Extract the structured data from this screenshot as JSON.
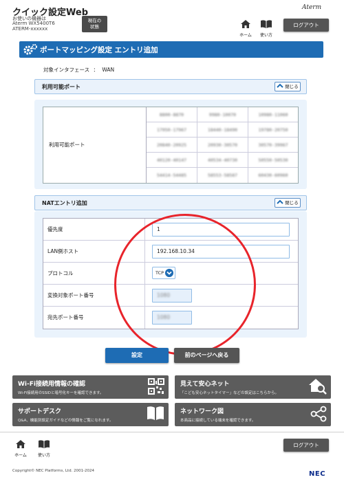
{
  "header": {
    "app_title": "クイック設定Web",
    "device_label": "お使いの機器は",
    "device_model": "Aterm WX5400T6",
    "device_id": "ATERM-xxxxxx",
    "status_button": "現在の\n状態",
    "brand": "Aterm",
    "nav_home": "ホーム",
    "nav_usage": "使い方",
    "logout": "ログアウト"
  },
  "page": {
    "title": "ポートマッピング設定 エントリ追加",
    "interface_label": "対象インタフェース",
    "interface_separator": "：",
    "interface_value": "WAN"
  },
  "available_ports": {
    "section_title": "利用可能ポート",
    "close_label": "閉じる",
    "row_label": "利用可能ポート",
    "cells": [
      [
        "8800-8870",
        "9980-10070",
        "10980-11060"
      ],
      [
        "17950-17967",
        "18440-18490",
        "19780-20750"
      ],
      [
        "20840-20925",
        "20930-30570",
        "30570-39967"
      ],
      [
        "40120-40147",
        "40534-40730",
        "50550-50530"
      ],
      [
        "54414-54485",
        "58553-58587",
        "60430-60960"
      ]
    ]
  },
  "nat_entry": {
    "section_title": "NATエントリ追加",
    "close_label": "閉じる",
    "rows": [
      {
        "label": "優先度",
        "value": "1"
      },
      {
        "label": "LAN側ホスト",
        "value": "192.168.10.34"
      },
      {
        "label": "プロトコル",
        "value": "TCP"
      },
      {
        "label": "変換対象ポート番号",
        "value": "1080"
      },
      {
        "label": "宛先ポート番号",
        "value": "1080"
      }
    ]
  },
  "actions": {
    "set": "設定",
    "back": "前のページへ戻る"
  },
  "tiles": [
    {
      "title": "Wi-Fi接続用情報の確認",
      "desc": "Wi-Fi接続用のSSIDと暗号化キーを確認できます。",
      "icon": "qr-code-icon"
    },
    {
      "title": "見えて安心ネット",
      "desc": "「こども安心ネットタイマー」などの設定はこちらから。",
      "icon": "home-search-icon"
    },
    {
      "title": "サポートデスク",
      "desc": "Q&A、機能別設定ガイドなどの情報をご覧になれます。",
      "icon": "book-icon"
    },
    {
      "title": "ネットワーク図",
      "desc": "本商品に接続している端末を確認できます。",
      "icon": "share-network-icon"
    }
  ],
  "footer": {
    "nav_home": "ホーム",
    "nav_usage": "使い方",
    "logout": "ログアウト",
    "copyright": "Copyright© NEC Platforms, Ltd. 2001-2024",
    "nec": "NEC"
  },
  "colors": {
    "accent_blue": "#1e6cb4",
    "dark_button": "#555555",
    "panel_bg": "#eaf3fc",
    "annotation_red": "#e8242b"
  }
}
